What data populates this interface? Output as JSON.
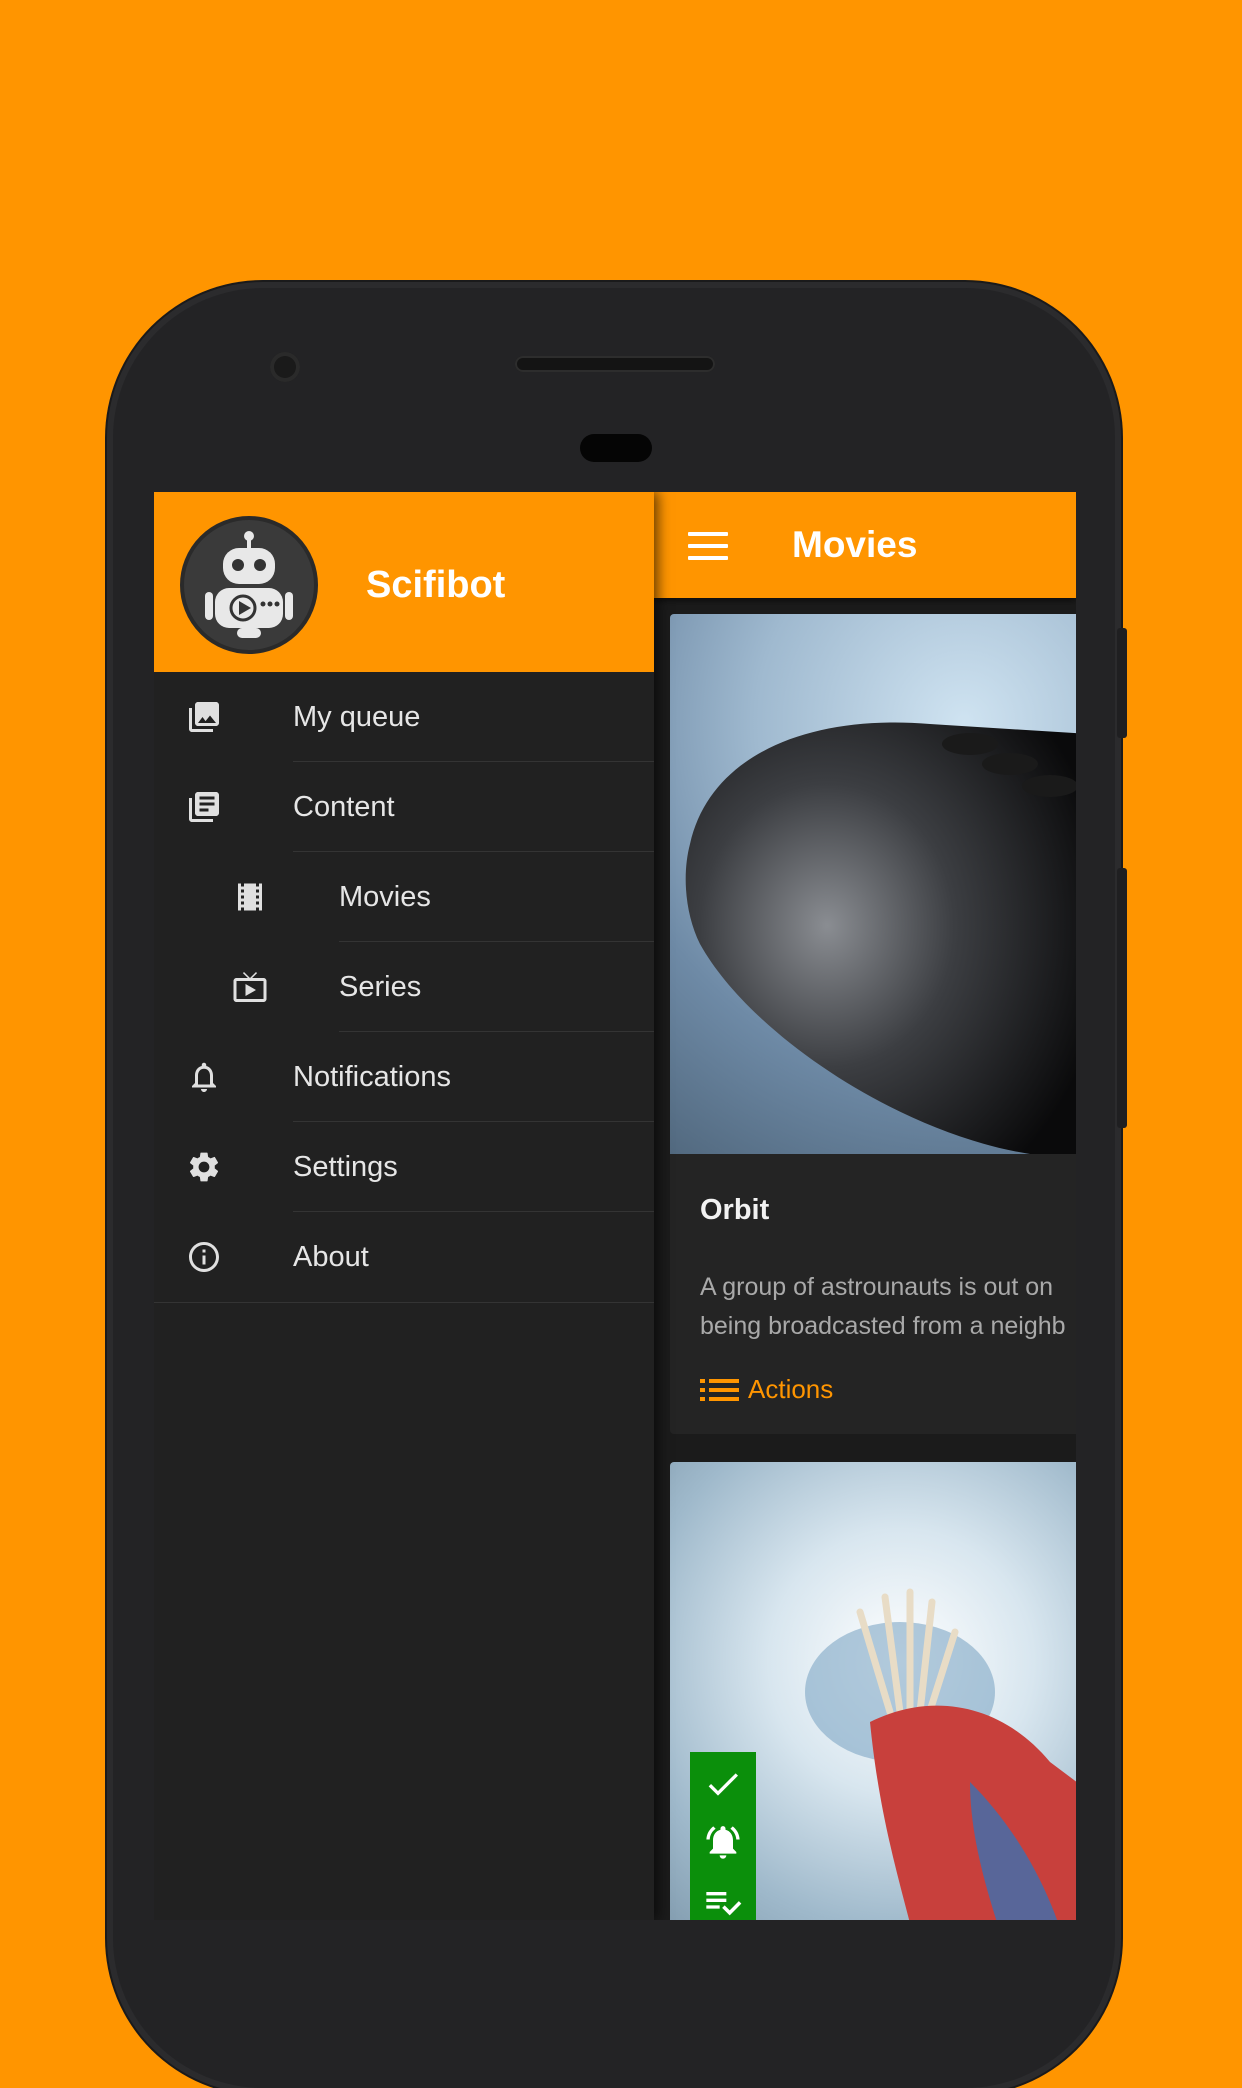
{
  "drawer": {
    "app_name": "Scifibot",
    "items": [
      {
        "label": "My queue",
        "icon": "photo-library-icon"
      },
      {
        "label": "Content",
        "icon": "library-books-icon"
      },
      {
        "label": "Movies",
        "icon": "film-icon"
      },
      {
        "label": "Series",
        "icon": "live-tv-icon"
      },
      {
        "label": "Notifications",
        "icon": "bell-icon"
      },
      {
        "label": "Settings",
        "icon": "gear-icon"
      },
      {
        "label": "About",
        "icon": "info-icon"
      }
    ]
  },
  "appbar": {
    "title": "Movies",
    "menu_icon": "hamburger-icon"
  },
  "card": {
    "title": "Orbit",
    "description_line1": "A group of astrounauts is out on",
    "description_line2": "being broadcasted from a neighb",
    "action_label": "Actions",
    "action_icon": "list-icon"
  },
  "badge": {
    "icons": [
      "check-icon",
      "alarm-icon",
      "playlist-check-icon"
    ],
    "color": "#0B8F0B"
  },
  "colors": {
    "accent": "#FF9500",
    "drawer_bg": "#212121",
    "card_bg": "#242424"
  }
}
